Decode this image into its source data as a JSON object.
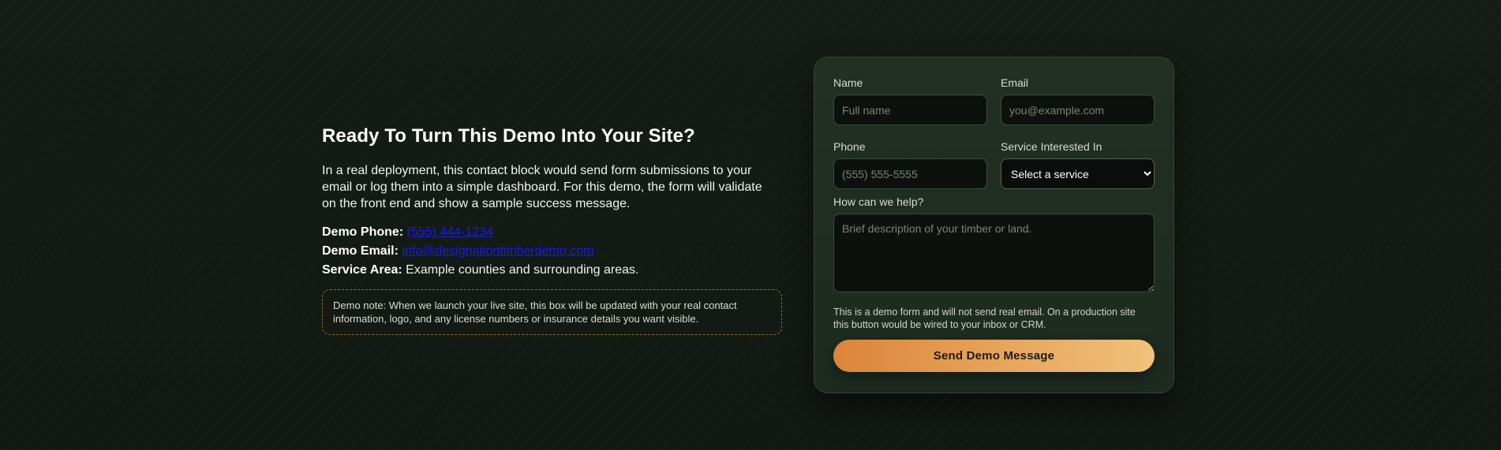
{
  "contact": {
    "heading": "Ready To Turn This Demo Into Your Site?",
    "lead": "In a real deployment, this contact block would send form submissions to your email or log them into a simple dashboard. For this demo, the form will validate on the front end and show a sample success message.",
    "phone_label": "Demo Phone:",
    "phone_value": "(555) 444-1234",
    "email_label": "Demo Email:",
    "email_value": "info@designationtimberdemo.com",
    "area_label": "Service Area:",
    "area_value": "Example counties and surrounding areas.",
    "note": "Demo note: When we launch your live site, this box will be updated with your real contact information, logo, and any license numbers or insurance details you want visible."
  },
  "form": {
    "name_label": "Name",
    "name_placeholder": "Full name",
    "email_label": "Email",
    "email_placeholder": "you@example.com",
    "phone_label": "Phone",
    "phone_placeholder": "(555) 555-5555",
    "service_label": "Service Interested In",
    "service_selected": "Select a service",
    "help_label": "How can we help?",
    "help_placeholder": "Brief description of your timber or land.",
    "disclaimer": "This is a demo form and will not send real email. On a production site this button would be wired to your inbox or CRM.",
    "submit_label": "Send Demo Message"
  },
  "colors": {
    "accent_start": "#dc843a",
    "accent_end": "#f0c27b",
    "link": "#1a1aee"
  }
}
